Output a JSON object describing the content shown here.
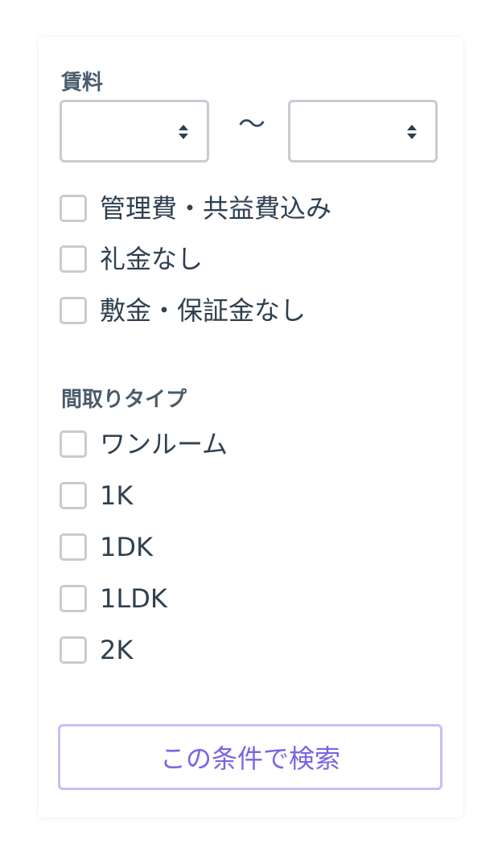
{
  "filters": {
    "rent": {
      "label": "賃料",
      "range_separator": "〜",
      "min_value": "",
      "max_value": "",
      "options": {
        "management_fee": "管理費・共益費込み",
        "no_key_money": "礼金なし",
        "no_deposit": "敷金・保証金なし"
      }
    },
    "layout": {
      "label": "間取りタイプ",
      "items": [
        "ワンルーム",
        "1K",
        "1DK",
        "1LDK",
        "2K"
      ]
    },
    "search_button": "この条件で検索"
  },
  "colors": {
    "label_text": "#4a5b6b",
    "body_text": "#2f4050",
    "border": "#c6ccd2",
    "accent": "#7b63e6",
    "accent_border": "#c9bdf7"
  },
  "icons": {
    "select_arrow": "sort-arrows-icon"
  }
}
